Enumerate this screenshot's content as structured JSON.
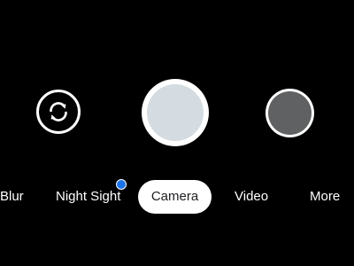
{
  "controls": {
    "switch_camera_icon": "switch-camera-icon",
    "shutter_icon": "shutter-button",
    "thumbnail_icon": "gallery-thumbnail"
  },
  "modes": {
    "items": [
      {
        "label": "Blur"
      },
      {
        "label": "Night Sight"
      },
      {
        "label": "Camera"
      },
      {
        "label": "Video"
      },
      {
        "label": "More"
      }
    ],
    "selected": "Camera",
    "new_indicator_color": "#1a73e8"
  },
  "colors": {
    "background": "#000000",
    "shutter_inner": "#d4dce1",
    "thumbnail_fill": "#606162",
    "accent": "#1a73e8"
  }
}
